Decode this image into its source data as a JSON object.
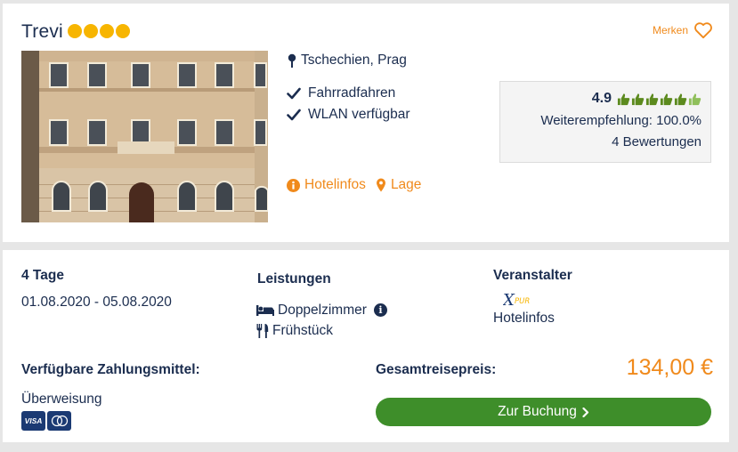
{
  "hotel": {
    "name": "Trevi",
    "stars": 4,
    "save_label": "Merken",
    "location": "Tschechien, Prag",
    "features": [
      "Fahrradfahren",
      "WLAN verfügbar"
    ],
    "links": {
      "info": "Hotelinfos",
      "map": "Lage"
    },
    "rating": {
      "score": "4.9",
      "thumbs": 5,
      "recommendation": "Weiterempfehlung: 100.0%",
      "reviews": "4 Bewertungen"
    }
  },
  "offer": {
    "duration": "4 Tage",
    "dates": "01.08.2020 - 05.08.2020",
    "services_title": "Leistungen",
    "room": "Doppelzimmer",
    "board": "Frühstück",
    "operator_title": "Veranstalter",
    "operator_logo": "XPUR",
    "operator_link": "Hotelinfos",
    "payment_title": "Verfügbare Zahlungsmittel:",
    "payment_method": "Überweisung",
    "payment_cards": [
      "VISA"
    ],
    "total_title": "Gesamtreisepreis:",
    "price": "134,00 €",
    "book_label": "Zur Buchung"
  },
  "colors": {
    "accent": "#f08a1c",
    "text": "#1b2d4f",
    "star": "#f7b500",
    "button": "#3e8e2a",
    "thumb": "#5c8a1e"
  },
  "icons": [
    "heart-icon",
    "map-pin-icon",
    "check-icon",
    "info-icon",
    "bed-icon",
    "cutlery-icon",
    "chevron-right-icon",
    "thumbs-up-icon"
  ]
}
